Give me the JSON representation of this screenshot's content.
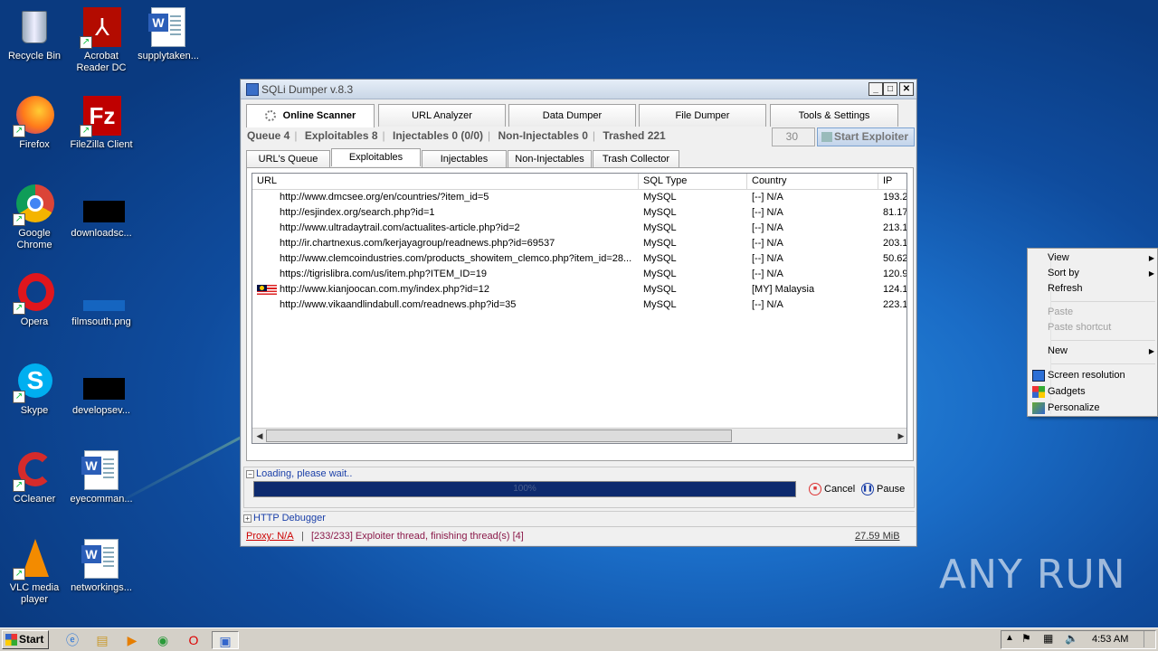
{
  "desktop": {
    "icons": [
      {
        "label": "Recycle Bin",
        "icon": "recycle-bin-icon"
      },
      {
        "label": "Acrobat Reader DC",
        "icon": "acrobat-icon"
      },
      {
        "label": "supplytaken...",
        "icon": "word-doc-icon"
      },
      {
        "label": "Firefox",
        "icon": "firefox-icon"
      },
      {
        "label": "FileZilla Client",
        "icon": "filezilla-icon"
      },
      {
        "label": "Google Chrome",
        "icon": "chrome-icon"
      },
      {
        "label": "downloadsc...",
        "icon": "image-file-icon"
      },
      {
        "label": "Opera",
        "icon": "opera-icon"
      },
      {
        "label": "filmsouth.png",
        "icon": "image-file-icon"
      },
      {
        "label": "Skype",
        "icon": "skype-icon"
      },
      {
        "label": "developsev...",
        "icon": "image-file-icon"
      },
      {
        "label": "CCleaner",
        "icon": "ccleaner-icon"
      },
      {
        "label": "eyecomman...",
        "icon": "word-doc-icon"
      },
      {
        "label": "VLC media player",
        "icon": "vlc-icon"
      },
      {
        "label": "networkings...",
        "icon": "word-doc-icon"
      }
    ],
    "watermark": "ANY RUN"
  },
  "window": {
    "title": "SQLi Dumper v.8.3",
    "tabs": [
      "Online Scanner",
      "URL Analyzer",
      "Data Dumper",
      "File Dumper",
      "Tools & Settings"
    ],
    "stats": {
      "queue": "Queue 4",
      "exploitables": "Exploitables 8",
      "injectables": "Injectables 0 (0/0)",
      "non_injectables": "Non-Injectables 0",
      "trashed": "Trashed 221"
    },
    "threads": "30",
    "start_button": "Start Exploiter",
    "subtabs": [
      "URL's Queue",
      "Exploitables",
      "Injectables",
      "Non-Injectables",
      "Trash Collector"
    ],
    "columns": [
      "URL",
      "SQL Type",
      "Country",
      "IP"
    ],
    "rows": [
      {
        "url": "http://www.dmcsee.org/en/countries/?item_id=5",
        "sql": "MySQL",
        "country": "[--] N/A",
        "ip": "193.2"
      },
      {
        "url": "http://esjindex.org/search.php?id=1",
        "sql": "MySQL",
        "country": "[--] N/A",
        "ip": "81.17"
      },
      {
        "url": "http://www.ultradaytrail.com/actualites-article.php?id=2",
        "sql": "MySQL",
        "country": "[--] N/A",
        "ip": "213.1"
      },
      {
        "url": "http://ir.chartnexus.com/kerjayagroup/readnews.php?id=69537",
        "sql": "MySQL",
        "country": "[--] N/A",
        "ip": "203.1"
      },
      {
        "url": "http://www.clemcoindustries.com/products_showitem_clemco.php?item_id=28...",
        "sql": "MySQL",
        "country": "[--] N/A",
        "ip": "50.62"
      },
      {
        "url": "https://tigrislibra.com/us/item.php?ITEM_ID=19",
        "sql": "MySQL",
        "country": "[--] N/A",
        "ip": "120.9"
      },
      {
        "url": "http://www.kianjoocan.com.my/index.php?id=12",
        "sql": "MySQL",
        "country": "[MY] Malaysia",
        "ip": "124.1"
      },
      {
        "url": "http://www.vikaandlindabull.com/readnews.php?id=35",
        "sql": "MySQL",
        "country": "[--] N/A",
        "ip": "223.1"
      }
    ],
    "loading_label": "Loading, please wait..",
    "progress_text": "100%",
    "progress_value": 1.0,
    "cancel_label": "Cancel",
    "pause_label": "Pause",
    "http_debugger": "HTTP Debugger",
    "proxy": "Proxy: N/A",
    "status_message": "[233/233] Exploiter thread, finishing thread(s) [4]",
    "memory": "27.59 MiB"
  },
  "context_menu": {
    "view": "View",
    "sort_by": "Sort by",
    "refresh": "Refresh",
    "paste": "Paste",
    "paste_shortcut": "Paste shortcut",
    "new": "New",
    "screen_resolution": "Screen resolution",
    "gadgets": "Gadgets",
    "personalize": "Personalize"
  },
  "taskbar": {
    "start": "Start",
    "clock": "4:53 AM"
  }
}
